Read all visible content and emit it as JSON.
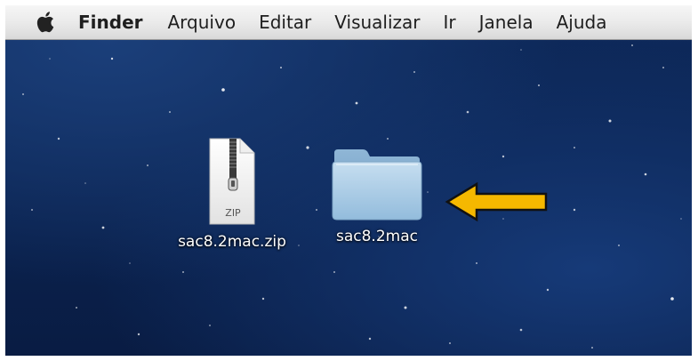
{
  "menubar": {
    "apple_icon": "apple-icon",
    "app_name": "Finder",
    "items": [
      "Arquivo",
      "Editar",
      "Visualizar",
      "Ir",
      "Janela",
      "Ajuda"
    ]
  },
  "desktop": {
    "icons": [
      {
        "label": "sac8.2mac.zip",
        "type": "zip-archive",
        "badge": "ZIP"
      },
      {
        "label": "sac8.2mac",
        "type": "folder"
      }
    ],
    "annotation": {
      "type": "arrow",
      "points_to": "sac8.2mac",
      "color": "#f5b800"
    }
  },
  "colors": {
    "desktop_bg": "#0b2452",
    "menubar_bg": "#e9e9e9",
    "folder": "#a9cbe3",
    "arrow_fill": "#f5b800"
  }
}
